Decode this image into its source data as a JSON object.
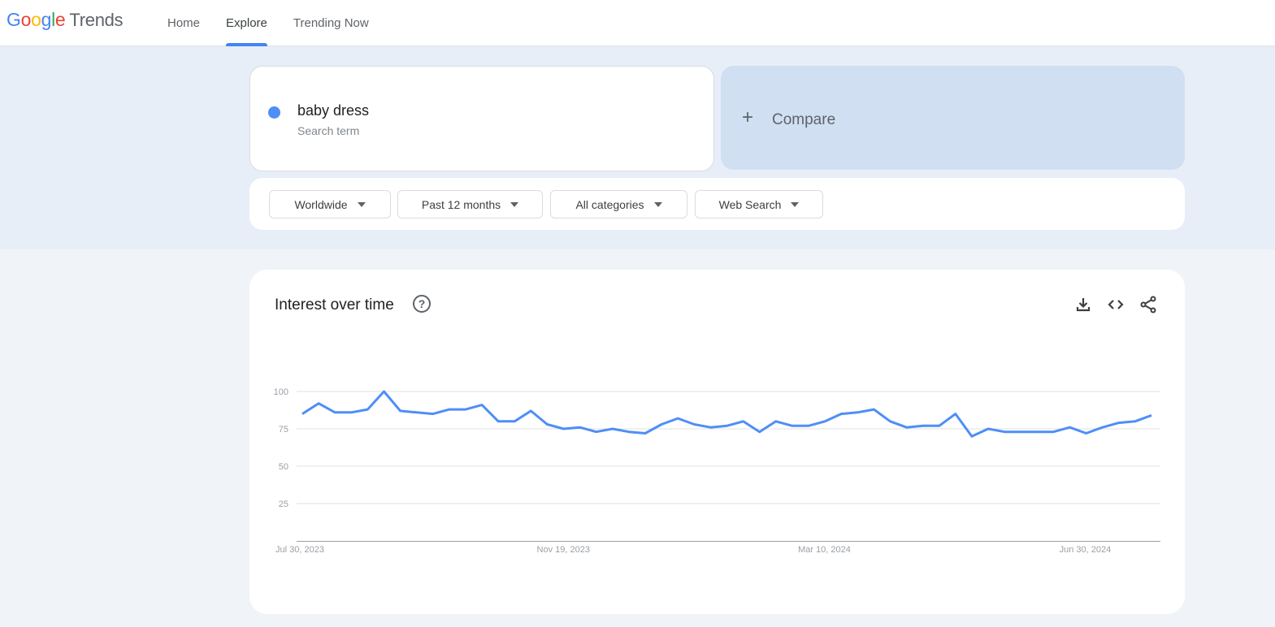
{
  "header": {
    "logo": {
      "letters": [
        "G",
        "o",
        "o",
        "g",
        "l",
        "e"
      ],
      "product": "Trends"
    },
    "nav": [
      {
        "label": "Home",
        "active": false
      },
      {
        "label": "Explore",
        "active": true
      },
      {
        "label": "Trending Now",
        "active": false
      }
    ]
  },
  "search": {
    "term": "baby dress",
    "term_type": "Search term",
    "term_color": "#4e8ef7",
    "compare_label": "Compare",
    "compare_icon": "plus-icon"
  },
  "filters": [
    {
      "label": "Worldwide"
    },
    {
      "label": "Past 12 months"
    },
    {
      "label": "All categories"
    },
    {
      "label": "Web Search"
    }
  ],
  "interest_card": {
    "title": "Interest over time",
    "help_icon": "help-circle-icon",
    "actions": [
      "download-icon",
      "embed-code-icon",
      "share-icon"
    ]
  },
  "chart_data": {
    "type": "line",
    "title": "Interest over time",
    "xlabel": "",
    "ylabel": "",
    "ylim": [
      0,
      100
    ],
    "yticks": [
      25,
      50,
      75,
      100
    ],
    "xtick_labels": [
      {
        "label": "Jul 30, 2023",
        "index": 0
      },
      {
        "label": "Nov 19, 2023",
        "index": 16
      },
      {
        "label": "Mar 10, 2024",
        "index": 32
      },
      {
        "label": "Jun 30, 2024",
        "index": 48
      }
    ],
    "grid": true,
    "legend": "none",
    "series": [
      {
        "name": "baby dress",
        "color": "#4e8ef7",
        "values": [
          85,
          92,
          86,
          86,
          88,
          100,
          87,
          86,
          85,
          88,
          88,
          91,
          80,
          80,
          87,
          78,
          75,
          76,
          73,
          75,
          73,
          72,
          78,
          82,
          78,
          76,
          77,
          80,
          73,
          80,
          77,
          77,
          80,
          85,
          86,
          88,
          80,
          76,
          77,
          77,
          85,
          70,
          75,
          73,
          73,
          73,
          73,
          76,
          72,
          76,
          79,
          80,
          84
        ]
      }
    ]
  }
}
